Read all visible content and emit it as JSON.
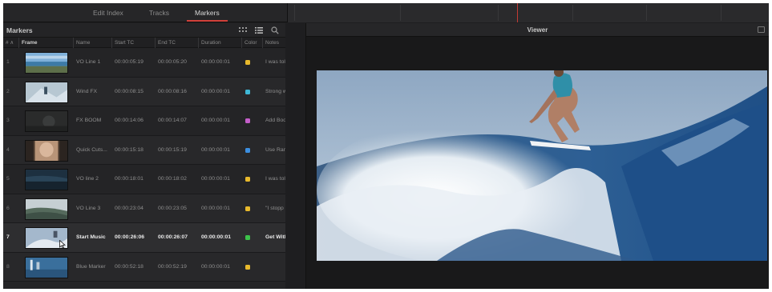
{
  "tabs": [
    {
      "label": "Edit Index",
      "active": false
    },
    {
      "label": "Tracks",
      "active": false
    },
    {
      "label": "Markers",
      "active": true
    }
  ],
  "panel": {
    "title": "Markers",
    "tools": [
      "grid-view-icon",
      "list-view-icon",
      "search-icon"
    ]
  },
  "columns": {
    "num": "# ∧",
    "frame": "Frame",
    "name": "Name",
    "start": "Start TC",
    "end": "End TC",
    "duration": "Duration",
    "color": "Color",
    "notes": "Notes"
  },
  "markers": [
    {
      "num": "1",
      "name": "VO Line 1",
      "start": "00:00:05:19",
      "end": "00:00:05:20",
      "duration": "00:00:00:01",
      "color": "#e8b92c",
      "notes": "I was tol"
    },
    {
      "num": "2",
      "name": "Wind FX",
      "start": "00:00:08:15",
      "end": "00:00:08:16",
      "duration": "00:00:00:01",
      "color": "#3fb8d6",
      "notes": "Strong w"
    },
    {
      "num": "3",
      "name": "FX BOOM",
      "start": "00:00:14:06",
      "end": "00:00:14:07",
      "duration": "00:00:00:01",
      "color": "#c45ec9",
      "notes": "Add Boo"
    },
    {
      "num": "4",
      "name": "Quick Cuts...",
      "start": "00:00:15:18",
      "end": "00:00:15:19",
      "duration": "00:00:00:01",
      "color": "#3c8fe0",
      "notes": "Use Ran"
    },
    {
      "num": "5",
      "name": "VO line 2",
      "start": "00:00:18:01",
      "end": "00:00:18:02",
      "duration": "00:00:00:01",
      "color": "#e8b92c",
      "notes": "I was tol"
    },
    {
      "num": "6",
      "name": "VO Line 3",
      "start": "00:00:23:04",
      "end": "00:00:23:05",
      "duration": "00:00:00:01",
      "color": "#e8b92c",
      "notes": "\"I stopp"
    },
    {
      "num": "7",
      "name": "Start Music",
      "start": "00:00:26:06",
      "end": "00:00:26:07",
      "duration": "00:00:00:01",
      "color": "#3cc24a",
      "notes": "Get With",
      "selected": true
    },
    {
      "num": "8",
      "name": "Blue Marker",
      "start": "00:00:52:18",
      "end": "00:00:52:19",
      "duration": "00:00:00:01",
      "color": "#e8b92c",
      "notes": ""
    }
  ],
  "viewer": {
    "title": "Viewer"
  },
  "colors": {
    "accent": "#d0403a",
    "panel": "#242426",
    "background": "#1e1e20"
  }
}
